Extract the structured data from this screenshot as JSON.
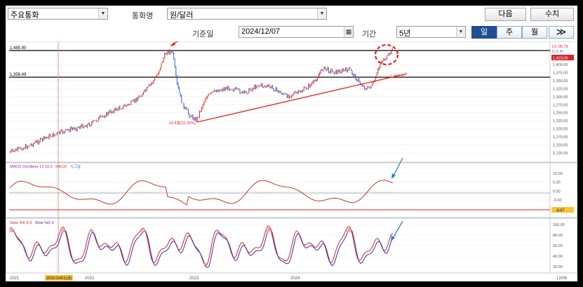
{
  "toolbar": {
    "currency_select": "주요통화",
    "pair_label": "통화명",
    "pair_select": "원/달러",
    "next_button": "다음",
    "value_button": "수치",
    "base_date_label": "기준일",
    "base_date": "2024/12/07",
    "period_label": "기간",
    "period_select": "5년",
    "period_buttons": [
      "일",
      "주",
      "월"
    ],
    "active_period": "일",
    "expand_icon": "double-chevron-right-icon"
  },
  "price_panel": {
    "top_left_label": "1,485.90",
    "ref_line_label": "1,358.49",
    "low_label": "12.4월(12.02%)",
    "trend_end_label": "1,368.87",
    "legend_top": "LC-05.78",
    "legend_second": "C-1.47",
    "last_price": "1,423.00",
    "y_ticks": [
      "1,400.00",
      "1,375.00",
      "1,350.00",
      "1,325.00",
      "1,300.00",
      "1,275.00",
      "1,250.00",
      "1,225.00",
      "1,200.00",
      "1,175.00",
      "1,150.00",
      "1,125.00"
    ]
  },
  "macd_panel": {
    "legend": [
      "MACD Oscillator 12,19,3",
      "MACD",
      "시그널"
    ],
    "y_ticks": [
      "10.00",
      "5.00",
      "0.00",
      "-5.00"
    ],
    "last_value": "-8.57"
  },
  "stoch_panel": {
    "legend": [
      "Slow %K 9,3",
      "Slow %D 3"
    ],
    "y_ticks": [
      "100.00",
      "80.00",
      "60.00",
      "40.00",
      "20.00"
    ]
  },
  "x_axis": {
    "labels": [
      "2021",
      "2022",
      "2023",
      "2024",
      "12/06"
    ],
    "cursor_label": "2021/10/01(금)"
  },
  "colors": {
    "price_up": "#d7262c",
    "price_down": "#2f5fc4",
    "annotation": "#e8201e",
    "blue_arrow": "#2a7fd4",
    "macd_line": "#c0392b",
    "k_line": "#c62828",
    "d_line": "#4527a0",
    "active_tab": "#1f4e95"
  },
  "icons": [
    "dropdown-arrow-icon",
    "calendar-icon",
    "double-chevron-right-icon",
    "red-arrow-icon",
    "blue-arrow-icon"
  ]
}
